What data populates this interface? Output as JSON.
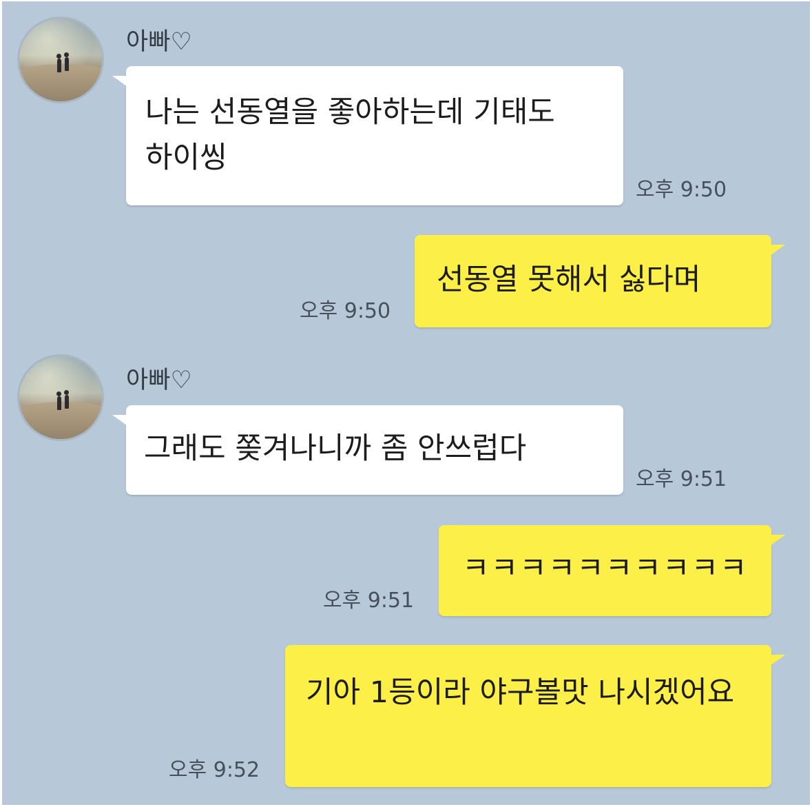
{
  "messages": [
    {
      "sender": "아빠♡",
      "text": "나는 선동열을 좋아하는데 기태도 하이씽",
      "time": "오후 9:50"
    },
    {
      "text": "선동열 못해서 싫다며",
      "time": "오후 9:50"
    },
    {
      "sender": "아빠♡",
      "text": "그래도 쫒겨나니까 좀 안쓰럽다",
      "time": "오후 9:51"
    },
    {
      "text": "ㅋㅋㅋㅋㅋㅋㅋㅋㅋㅋ",
      "time": "오후 9:51"
    },
    {
      "text": "기아 1등이라 야구볼맛 나시겠어요",
      "time": "오후 9:52"
    }
  ],
  "colors": {
    "background": "#b7c8d9",
    "incoming_bubble": "#ffffff",
    "outgoing_bubble": "#fcf048"
  },
  "icons": {
    "avatar": "profile-photo-couple-on-beach"
  }
}
